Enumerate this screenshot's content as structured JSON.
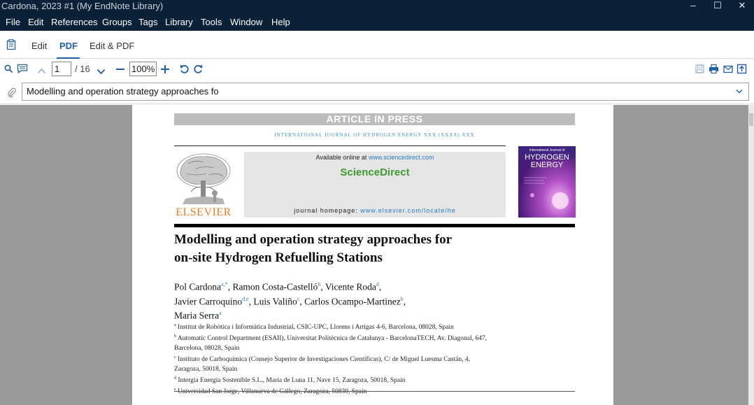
{
  "window": {
    "title": "Cardona, 2023 #1 (My EndNote Library)",
    "minimize": "–",
    "maximize": "☐",
    "close": "✕"
  },
  "menu": [
    "File",
    "Edit",
    "References",
    "Groups",
    "Tags",
    "Library",
    "Tools",
    "Window",
    "Help"
  ],
  "tabs": {
    "edit": "Edit",
    "pdf": "PDF",
    "edit_pdf": "Edit & PDF",
    "active": "PDF"
  },
  "toolbar": {
    "page_current": "1",
    "page_total": "/ 16",
    "zoom": "100%",
    "icons": [
      "search-icon",
      "comment-icon",
      "chevron-up-icon",
      "chevron-down-icon",
      "zoom-out-icon",
      "zoom-in-icon",
      "rotate-left-icon",
      "rotate-right-icon",
      "save-icon",
      "print-icon",
      "email-icon",
      "open-external-icon"
    ]
  },
  "attachment": {
    "selected": "Modelling and operation strategy approaches fo"
  },
  "pdf_page": {
    "banner": "ARTICLE IN PRESS",
    "journal_line": "INTERNATIONAL JOURNAL OF HYDROGEN ENERGY XXX (XXXX) XXX",
    "available_prefix": "Available online at ",
    "available_link": "www.sciencedirect.com",
    "sd_brand": "ScienceDirect",
    "homepage_prefix": "journal homepage: ",
    "homepage_link": "www.elsevier.com/locate/he",
    "publisher": "ELSEVIER",
    "cover_line1": "International Journal of",
    "cover_line2": "HYDROGEN",
    "cover_line3": "ENERGY",
    "title_line1": "Modelling and operation strategy approaches for",
    "title_line2": "on-site Hydrogen Refuelling Stations",
    "authors": [
      {
        "name": "Pol Cardona",
        "sup": "a,*",
        "sep": ", "
      },
      {
        "name": "Ramon Costa-Castelló",
        "sup": "b",
        "sep": ", "
      },
      {
        "name": "Vicente Roda",
        "sup": "d",
        "sep": ","
      },
      {
        "name": "Javier Carroquino",
        "sup": "d,e",
        "sep": ", "
      },
      {
        "name": "Luis Valiño",
        "sup": "c",
        "sep": ", "
      },
      {
        "name": "Carlos Ocampo-Martinez",
        "sup": "b",
        "sep": ","
      },
      {
        "name": "Maria Serra",
        "sup": "a",
        "sep": ""
      }
    ],
    "affiliations": [
      {
        "sup": "a",
        "text": "Institut de Robòtica i Informàtica Industrial, CSIC-UPC, Llorens i Artigas 4-6, Barcelona, 08028, Spain"
      },
      {
        "sup": "b",
        "text": "Automatic Control Department (ESAII), Universitat Politècnica de Catalunya - BarcelonaTECH, Av. Diagonal, 647,"
      },
      {
        "sup": "",
        "text": "Barcelona, 08028, Spain"
      },
      {
        "sup": "c",
        "text": "Instituto de Carboquímica (Consejo Superior de Investigaciones Científicas), C/ de Miguel Luesma Castán, 4,"
      },
      {
        "sup": "",
        "text": "Zaragoza, 50018, Spain"
      },
      {
        "sup": "d",
        "text": "Intergia Energía Sostenible S.L., María de Luna 11, Nave 15, Zaragoza, 50018, Spain"
      },
      {
        "sup": "e",
        "text": "Universidad San Jorge, Villanueva de Gállego, Zaragoza, 50830, Spain"
      }
    ]
  },
  "colors": {
    "titlebar": "#0b2138",
    "accent": "#1f5fa7",
    "viewer_bg": "#9a9a9a",
    "sd_green": "#3e9a2f",
    "elsevier_orange": "#f07c1f",
    "link_blue": "#2a7bc2"
  }
}
